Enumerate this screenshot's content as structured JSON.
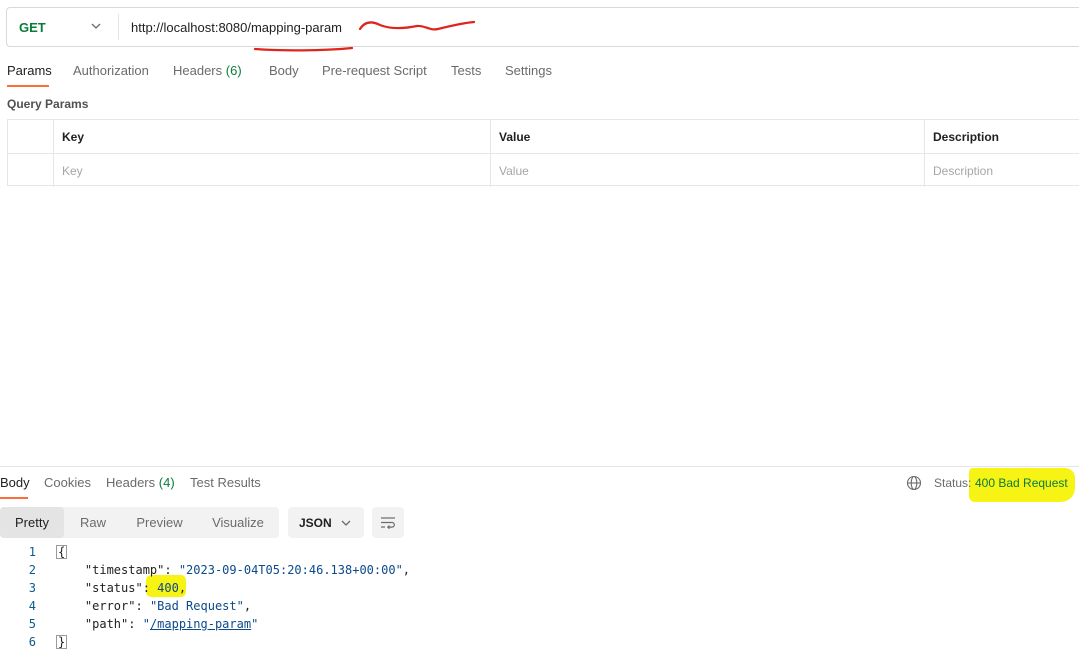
{
  "request": {
    "method": "GET",
    "url": "http://localhost:8080/mapping-param"
  },
  "request_tabs": [
    {
      "label": "Params",
      "count": ""
    },
    {
      "label": "Authorization",
      "count": ""
    },
    {
      "label": "Headers",
      "count": "(6)"
    },
    {
      "label": "Body",
      "count": ""
    },
    {
      "label": "Pre-request Script",
      "count": ""
    },
    {
      "label": "Tests",
      "count": ""
    },
    {
      "label": "Settings",
      "count": ""
    }
  ],
  "query_params": {
    "title": "Query Params",
    "headers": [
      "Key",
      "Value",
      "Description"
    ],
    "placeholders": [
      "Key",
      "Value",
      "Description"
    ]
  },
  "response_tabs": [
    {
      "label": "Body",
      "count": ""
    },
    {
      "label": "Cookies",
      "count": ""
    },
    {
      "label": "Headers",
      "count": "(4)"
    },
    {
      "label": "Test Results",
      "count": ""
    }
  ],
  "status": {
    "label": "Status:",
    "value": "400 Bad Request"
  },
  "view_modes": [
    "Pretty",
    "Raw",
    "Preview",
    "Visualize"
  ],
  "format": "JSON",
  "code_lines": [
    {
      "num": "1",
      "tokens": [
        {
          "t": "b",
          "v": "{"
        }
      ]
    },
    {
      "num": "2",
      "tokens": [
        {
          "t": "k",
          "v": "    \"timestamp\""
        },
        {
          "t": "p",
          "v": ": "
        },
        {
          "t": "s",
          "v": "\"2023-09-04T05:20:46.138+00:00\""
        },
        {
          "t": "p",
          "v": ","
        }
      ]
    },
    {
      "num": "3",
      "tokens": [
        {
          "t": "k",
          "v": "    \"status\""
        },
        {
          "t": "p",
          "v": ": "
        },
        {
          "t": "n",
          "v": "400"
        },
        {
          "t": "p",
          "v": ","
        }
      ]
    },
    {
      "num": "4",
      "tokens": [
        {
          "t": "k",
          "v": "    \"error\""
        },
        {
          "t": "p",
          "v": ": "
        },
        {
          "t": "s",
          "v": "\"Bad Request\""
        },
        {
          "t": "p",
          "v": ","
        }
      ]
    },
    {
      "num": "5",
      "tokens": [
        {
          "t": "k",
          "v": "    \"path\""
        },
        {
          "t": "p",
          "v": ": "
        },
        {
          "t": "s",
          "v": "\""
        },
        {
          "t": "l",
          "v": "/mapping-param"
        },
        {
          "t": "s",
          "v": "\""
        }
      ]
    },
    {
      "num": "6",
      "tokens": [
        {
          "t": "b",
          "v": "}"
        }
      ]
    }
  ],
  "colors": {
    "accent": "#ff6c37",
    "method_get": "#0a7c3a",
    "highlight": "#f7f314",
    "annotation": "#e0241b"
  }
}
